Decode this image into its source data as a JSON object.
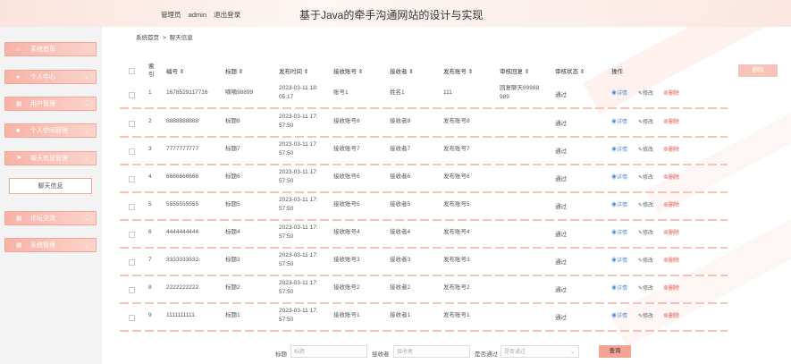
{
  "header": {
    "role": "管理员",
    "username": "admin",
    "logout": "退出登录",
    "site_title": "基于Java的牵手沟通网站的设计与实现"
  },
  "sidebar": {
    "items": [
      {
        "label": "系统首页",
        "icon": "home-icon"
      },
      {
        "label": "个人中心",
        "icon": "person-icon"
      },
      {
        "label": "用户管理",
        "icon": "grid-icon"
      },
      {
        "label": "个人空间管理",
        "icon": "square-icon"
      },
      {
        "label": "聊天信息管理",
        "icon": "flag-icon"
      },
      {
        "label": "论坛交流",
        "icon": "grid-icon"
      },
      {
        "label": "系统管理",
        "icon": "grid-icon"
      }
    ],
    "sub_item": "聊天信息"
  },
  "breadcrumb": {
    "home": "系统首页",
    "sep": ">",
    "current": "聊天信息"
  },
  "toolbar": {
    "delete_label": "删除"
  },
  "table": {
    "headers": [
      "索引",
      "编号 ⇕",
      "标题 ⇕",
      "发布时间 ⇕",
      "接收账号 ⇕",
      "接收者 ⇕",
      "发布账号 ⇕",
      "审核回复 ⇕",
      "审核状态 ⇕",
      "操作"
    ],
    "index_line1": "索",
    "index_line2": "引",
    "actions": {
      "detail": "详情",
      "edit": "修改",
      "remove": "删除"
    },
    "rows": [
      {
        "idx": "1",
        "code": "1678529117716",
        "title": "嘀嘀98899",
        "time1": "2023-03-11 18:",
        "time2": "05:17",
        "recv_acc": "账号1",
        "receiver": "姓名1",
        "pub_acc": "111",
        "reply1": "回复聊天89988",
        "reply2": "989",
        "status": "通过"
      },
      {
        "idx": "2",
        "code": "8888888888",
        "title": "标题8",
        "time1": "2023-03-11 17:",
        "time2": "57:50",
        "recv_acc": "接收账号8",
        "receiver": "接收者8",
        "pub_acc": "发布账号8",
        "reply1": "",
        "reply2": "",
        "status": "通过"
      },
      {
        "idx": "3",
        "code": "7777777777",
        "title": "标题7",
        "time1": "2023-03-11 17:",
        "time2": "57:50",
        "recv_acc": "接收账号7",
        "receiver": "接收者7",
        "pub_acc": "发布账号7",
        "reply1": "",
        "reply2": "",
        "status": "通过"
      },
      {
        "idx": "4",
        "code": "6666666666",
        "title": "标题6",
        "time1": "2023-03-11 17:",
        "time2": "57:50",
        "recv_acc": "接收账号6",
        "receiver": "接收者6",
        "pub_acc": "发布账号6",
        "reply1": "",
        "reply2": "",
        "status": "通过"
      },
      {
        "idx": "5",
        "code": "5555555555",
        "title": "标题5",
        "time1": "2023-03-11 17:",
        "time2": "57:50",
        "recv_acc": "接收账号5",
        "receiver": "接收者5",
        "pub_acc": "发布账号5",
        "reply1": "",
        "reply2": "",
        "status": "通过"
      },
      {
        "idx": "6",
        "code": "4444444444",
        "title": "标题4",
        "time1": "2023-03-11 17:",
        "time2": "57:50",
        "recv_acc": "接收账号4",
        "receiver": "接收者4",
        "pub_acc": "发布账号4",
        "reply1": "",
        "reply2": "",
        "status": "通过"
      },
      {
        "idx": "7",
        "code": "3333333333",
        "title": "标题3",
        "time1": "2023-03-11 17:",
        "time2": "57:50",
        "recv_acc": "接收账号3",
        "receiver": "接收者3",
        "pub_acc": "发布账号3",
        "reply1": "",
        "reply2": "",
        "status": "通过"
      },
      {
        "idx": "8",
        "code": "2222222222",
        "title": "标题2",
        "time1": "2023-03-11 17:",
        "time2": "57:50",
        "recv_acc": "接收账号2",
        "receiver": "接收者2",
        "pub_acc": "发布账号2",
        "reply1": "",
        "reply2": "",
        "status": "通过"
      },
      {
        "idx": "9",
        "code": "1111111111",
        "title": "标题1",
        "time1": "2023-03-11 17:",
        "time2": "57:50",
        "recv_acc": "接收账号1",
        "receiver": "接收者1",
        "pub_acc": "发布账号1",
        "reply1": "",
        "reply2": "",
        "status": "通过"
      }
    ]
  },
  "search": {
    "title_label": "标题",
    "title_placeholder": "标题",
    "receiver_label": "接收者",
    "receiver_placeholder": "接收者",
    "approve_label": "是否通过",
    "approve_placeholder": "是否通过",
    "query_label": "查询"
  }
}
